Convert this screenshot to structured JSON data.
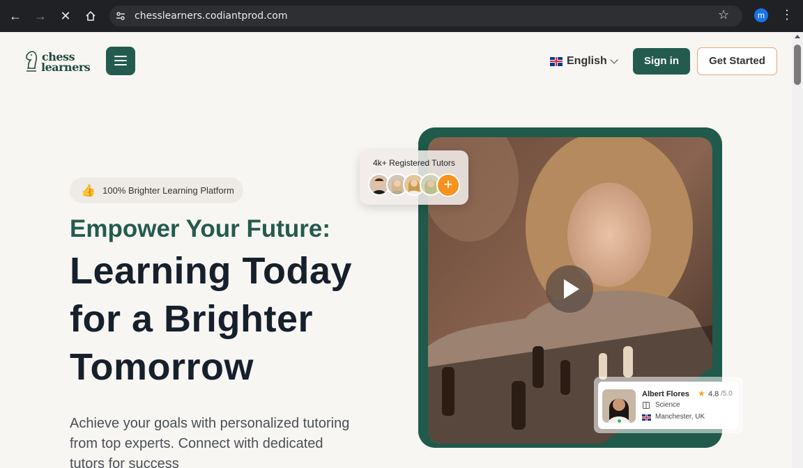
{
  "browser": {
    "url": "chesslearners.codiantprod.com",
    "profile_initial": "m"
  },
  "header": {
    "logo_line1": "chess",
    "logo_line2": "learners",
    "language": "English",
    "signin_label": "Sign in",
    "get_started_label": "Get Started"
  },
  "hero": {
    "badge_text": "100% Brighter Learning Platform",
    "headline_green": "Empower Your Future:",
    "headline_lines": [
      "Learning Today",
      "for a Brighter",
      "Tomorrow"
    ],
    "lead": "Achieve your goals with personalized tutoring from top experts. Connect with dedicated tutors for success"
  },
  "tutors_popup": {
    "title": "4k+ Registered Tutors",
    "plus": "+"
  },
  "tutor_card": {
    "name": "Albert Flores",
    "rating": "4.8",
    "rating_max": "/5.0",
    "subject": "Science",
    "location": "Manchester, UK"
  },
  "colors": {
    "brand_green": "#245b4f",
    "accent_orange": "#f6921e",
    "page_bg": "#f8f6f3"
  }
}
